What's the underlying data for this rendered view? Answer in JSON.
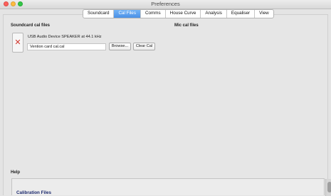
{
  "window": {
    "title": "Preferences"
  },
  "tabs": [
    {
      "label": "Soundcard",
      "active": false
    },
    {
      "label": "Cal Files",
      "active": true
    },
    {
      "label": "Comms",
      "active": false
    },
    {
      "label": "House Curve",
      "active": false
    },
    {
      "label": "Analysis",
      "active": false
    },
    {
      "label": "Equaliser",
      "active": false
    },
    {
      "label": "View",
      "active": false
    }
  ],
  "soundcard_cal": {
    "heading": "Soundcard cal files",
    "device": "USB Audio Device SPEAKER at 44.1 kHz",
    "file_value": "Vention card cal.cal",
    "browse_label": "Browse...",
    "clear_label": "Clear Cal",
    "status_icon": "x-mark-icon"
  },
  "mic_cal": {
    "heading": "Mic cal files"
  },
  "help": {
    "heading": "Help",
    "title": "Calibration Files"
  },
  "colors": {
    "active_tab": "#4a90e6",
    "status_x": "#d0352c",
    "help_title": "#1c2a6e"
  }
}
